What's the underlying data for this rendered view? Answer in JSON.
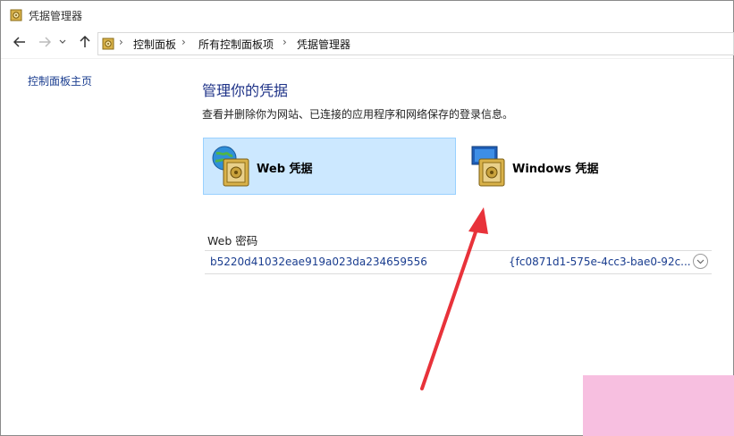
{
  "window": {
    "title": "凭据管理器"
  },
  "nav": {
    "breadcrumbs": [
      "控制面板",
      "所有控制面板项",
      "凭据管理器"
    ],
    "separator": "›"
  },
  "sidebar": {
    "home_link": "控制面板主页"
  },
  "main": {
    "title": "管理你的凭据",
    "description": "查看并删除你为网站、已连接的应用程序和网络保存的登录信息。",
    "tiles": [
      {
        "label": "Web 凭据",
        "selected": true,
        "icon": "web-credentials-icon"
      },
      {
        "label": "Windows 凭据",
        "selected": false,
        "icon": "windows-credentials-icon"
      }
    ],
    "section": {
      "title": "Web 密码",
      "rows": [
        {
          "address": "b5220d41032eae919a023da234659556",
          "user": "{fc0871d1-575e-4cc3-bae0-92c..."
        }
      ]
    }
  },
  "colors": {
    "accent": "#1e3287",
    "selected_tile": "#cce8ff",
    "arrow": "#e8323a"
  }
}
